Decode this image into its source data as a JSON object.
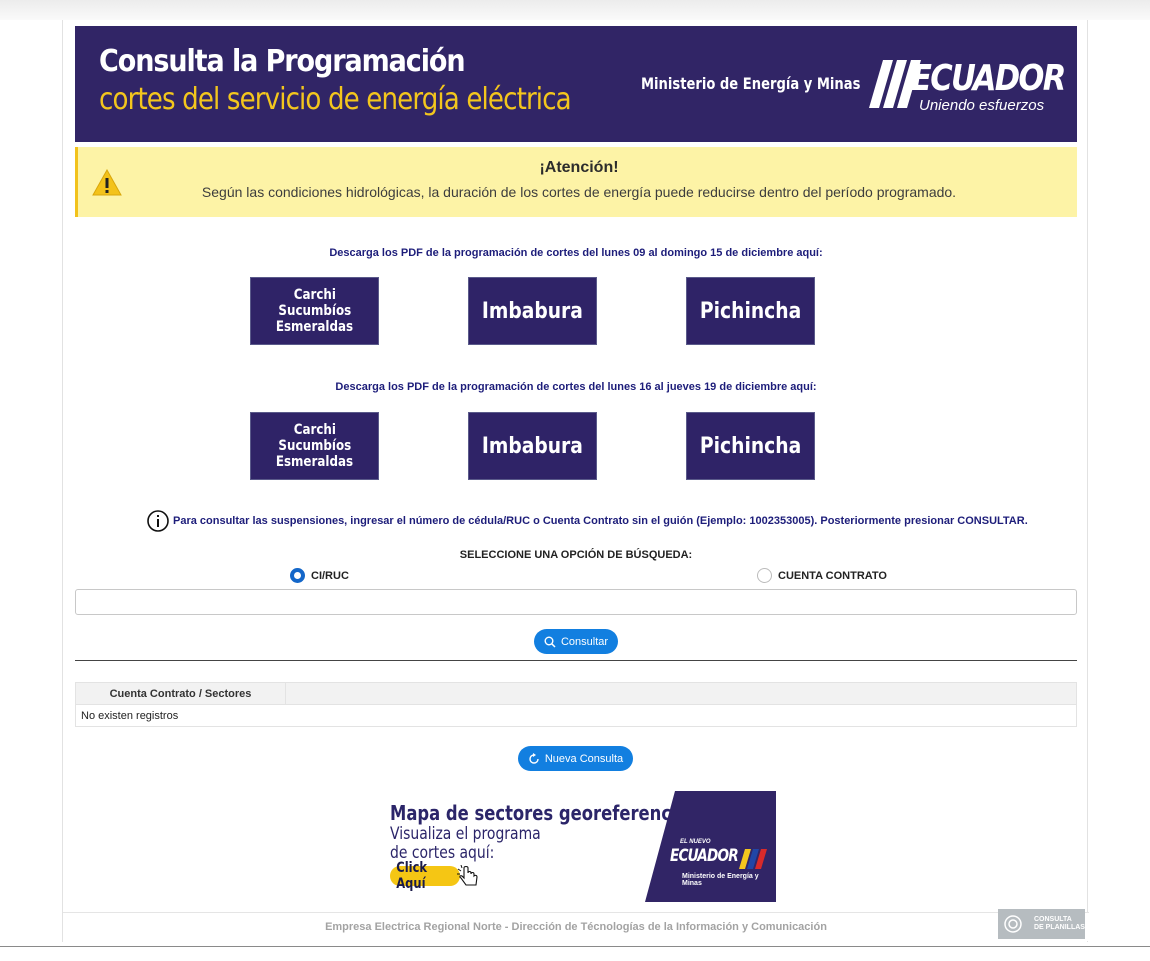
{
  "header": {
    "title": "Consulta la Programación",
    "subtitle": "cortes del servicio de energía eléctrica",
    "ministry": "Ministerio de Energía y Minas",
    "logo_word": "ECUADOR",
    "logo_slogan": "Uniendo esfuerzos",
    "colors": {
      "banner": "#312566",
      "subtitle": "#f3c61d"
    }
  },
  "alert": {
    "title": "¡Atención!",
    "text": "Según las condiciones hidrológicas, la duración de los cortes de energía puede reducirse dentro del período programado.",
    "icon": "warning-icon"
  },
  "downloads": [
    {
      "label": "Descarga los PDF de la programación de cortes del lunes 09 al domingo 15 de diciembre aquí:",
      "buttons": {
        "carchi": "Carchi",
        "sucumbios": "Sucumbíos",
        "esmeraldas": "Esmeraldas",
        "imbabura": "Imbabura",
        "pichincha": "Pichincha"
      }
    },
    {
      "label": "Descarga los PDF de la programación de cortes del lunes 16 al jueves 19 de diciembre aquí:",
      "buttons": {
        "carchi": "Carchi",
        "sucumbios": "Sucumbíos",
        "esmeraldas": "Esmeraldas",
        "imbabura": "Imbabura",
        "pichincha": "Pichincha"
      }
    }
  ],
  "search": {
    "info": "Para consultar las suspensiones, ingresar el número de cédula/RUC o Cuenta Contrato sin el guión (Ejemplo: 1002353005). Posteriormente presionar CONSULTAR.",
    "select_label": "SELECCIONE UNA OPCIÓN DE BÚSQUEDA:",
    "option_ci": "CI/RUC",
    "option_contrato": "CUENTA CONTRATO",
    "selected": "CI/RUC",
    "input_value": "",
    "consultar": "Consultar"
  },
  "table": {
    "header": "Cuenta Contrato / Sectores",
    "empty": "No existen registros"
  },
  "nueva_consulta": "Nueva Consulta",
  "promo": {
    "title": "Mapa de sectores georeferenciados",
    "line1": "Visualiza el programa",
    "line2": "de cortes aquí:",
    "click": "Click Aquí",
    "panel_small": "EL NUEVO",
    "panel_word": "ECUADOR",
    "panel_ministry": "Ministerio de Energía y Minas"
  },
  "footer": {
    "text": "Empresa Electrica Regional Norte - Dirección de Técnologías de la Información y Comunicación",
    "badge_line1": "CONSULTA",
    "badge_line2": "DE PLANILLAS"
  }
}
